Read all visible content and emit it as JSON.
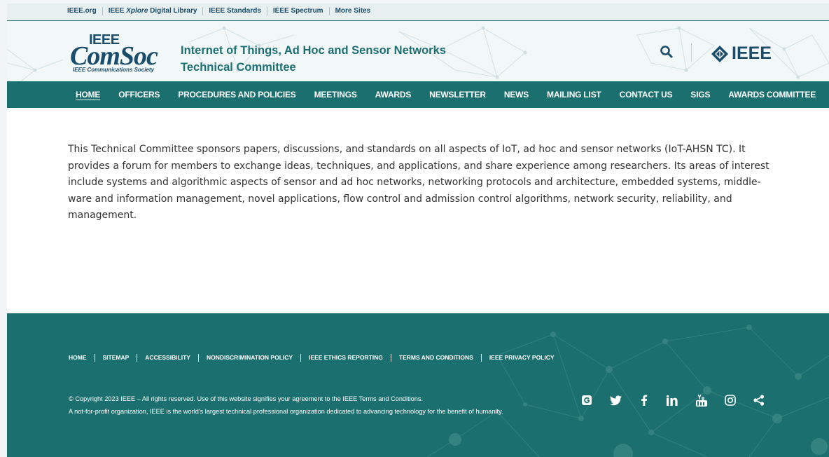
{
  "top_links": [
    "IEEE.org",
    "IEEE Xplore Digital Library",
    "IEEE Standards",
    "IEEE Spectrum",
    "More Sites"
  ],
  "logo": {
    "ieee": "IEEE",
    "comsoc": "ComSoc",
    "tagline": "IEEE Communications Society"
  },
  "site_title": {
    "line1": "Internet of Things, Ad Hoc and Sensor Networks",
    "line2": "Technical Committee"
  },
  "ieee_brand": "IEEE",
  "nav": [
    "HOME",
    "OFFICERS",
    "PROCEDURES AND POLICIES",
    "MEETINGS",
    "AWARDS",
    "NEWSLETTER",
    "NEWS",
    "MAILING LIST",
    "CONTACT US",
    "SIGS",
    "AWARDS COMMITTEE"
  ],
  "main_text": "This Technical Committee sponsors papers, discussions, and standards on all aspects of IoT, ad hoc and sensor networks (IoT-AHSN TC). It provides a forum for members to exchange ideas, techniques, and applications, and share experience among researchers. Its areas of interest include systems and algorithmic aspects of sensor and ad hoc networks, networking protocols and architecture, embedded systems, middle-ware and information management, novel applications, flow control and admission control algorithms, network security, reliability, and management.",
  "footer_links": [
    "HOME",
    "SITEMAP",
    "ACCESSIBILITY",
    "NONDISCRIMINATION POLICY",
    "IEEE ETHICS REPORTING",
    "TERMS AND CONDITIONS",
    "IEEE PRIVACY POLICY"
  ],
  "copyright": {
    "line1": "© Copyright 2023 IEEE – All rights reserved. Use of this website signifies your agreement to the IEEE Terms and Conditions.",
    "line2": "A not-for-profit organization, IEEE is the world's largest technical professional organization dedicated to advancing technology for the benefit of humanity."
  },
  "social": [
    "ieee-collabratec-icon",
    "twitter-icon",
    "facebook-icon",
    "linkedin-icon",
    "youtube-icon",
    "instagram-icon",
    "share-icon"
  ],
  "colors": {
    "teal": "#1b6f6e",
    "navy": "#1a4d6b",
    "title": "#1d6f73"
  }
}
